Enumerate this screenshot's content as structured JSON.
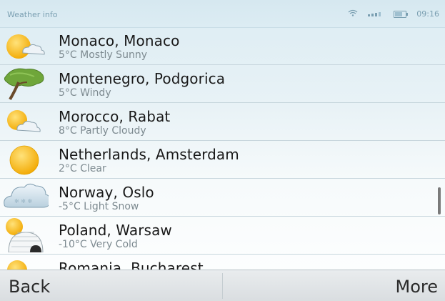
{
  "status_bar": {
    "title": "Weather info",
    "time": "09:16",
    "icons": [
      "wifi-icon",
      "signal-icon",
      "battery-icon"
    ]
  },
  "locations": [
    {
      "city": "Monaco, Monaco",
      "condition": "5°C Mostly Sunny",
      "icon": "mostly-sunny-icon"
    },
    {
      "city": "Montenegro, Podgorica",
      "condition": "5°C Windy",
      "icon": "windy-tree-icon"
    },
    {
      "city": "Morocco, Rabat",
      "condition": "8°C Partly Cloudy",
      "icon": "partly-cloudy-icon"
    },
    {
      "city": "Netherlands, Amsterdam",
      "condition": "2°C Clear",
      "icon": "clear-sun-icon"
    },
    {
      "city": "Norway, Oslo",
      "condition": "-5°C Light Snow",
      "icon": "light-snow-icon"
    },
    {
      "city": "Poland, Warsaw",
      "condition": "-10°C Very Cold",
      "icon": "very-cold-igloo-icon"
    },
    {
      "city": "Romania, Bucharest",
      "condition": "",
      "icon": "sun-icon"
    }
  ],
  "softkeys": {
    "left": "Back",
    "right": "More"
  }
}
